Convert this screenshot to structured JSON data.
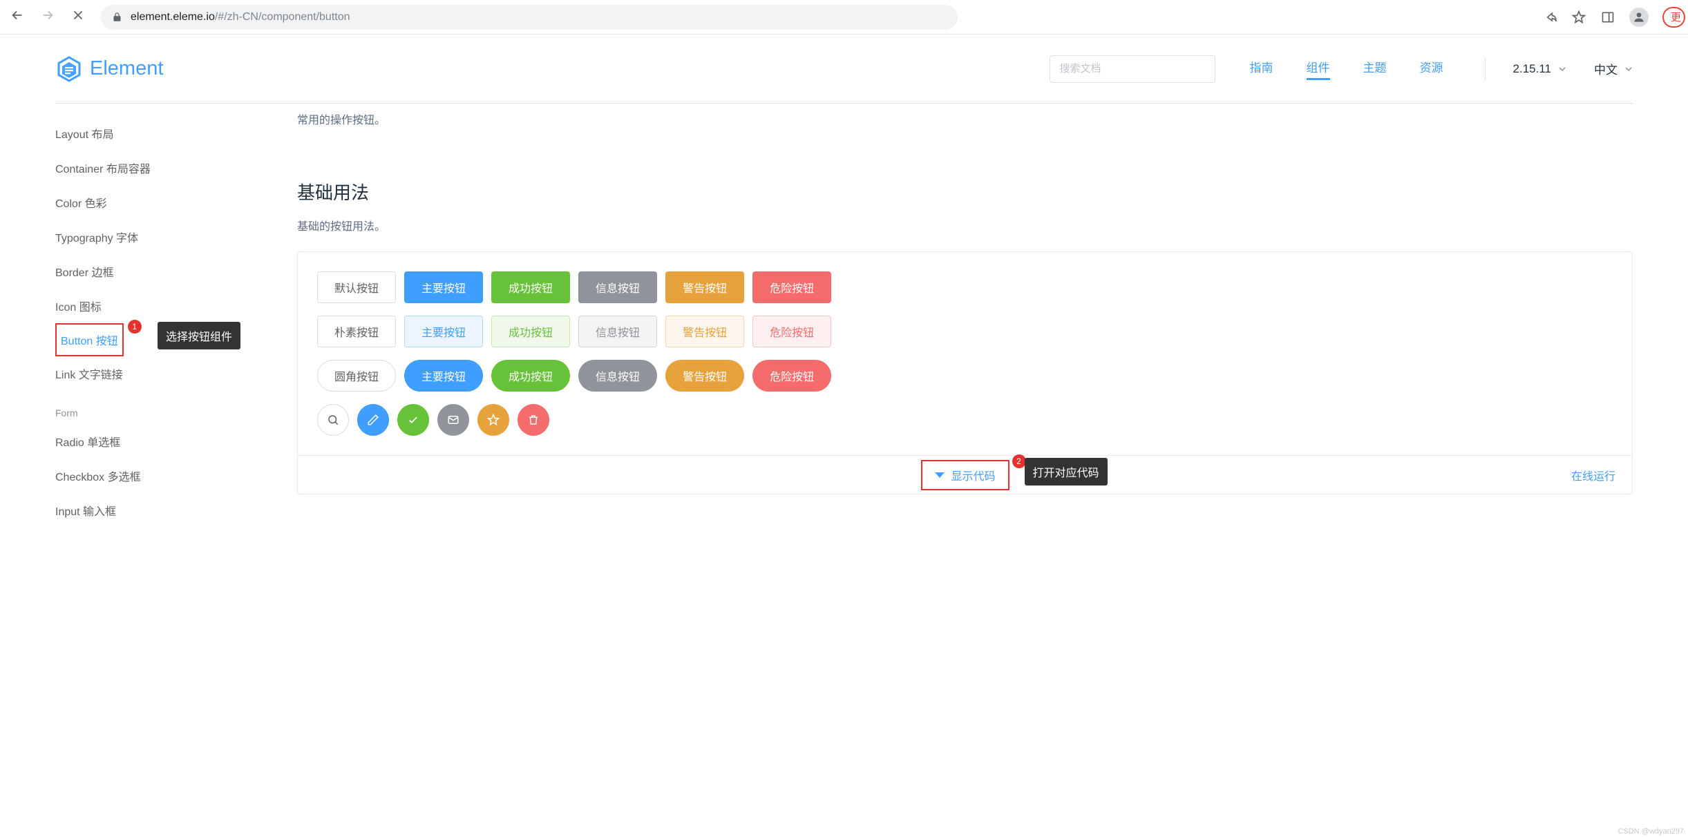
{
  "browser": {
    "url_host": "element.eleme.io",
    "url_path": "/#/zh-CN/component/button",
    "more_label": "更"
  },
  "header": {
    "logo_text": "Element",
    "search_placeholder": "搜索文档",
    "nav": {
      "guide": "指南",
      "component": "组件",
      "theme": "主题",
      "resource": "资源"
    },
    "version": "2.15.11",
    "lang": "中文"
  },
  "sidebar": {
    "items": [
      {
        "label": "Layout 布局"
      },
      {
        "label": "Container 布局容器"
      },
      {
        "label": "Color 色彩"
      },
      {
        "label": "Typography 字体"
      },
      {
        "label": "Border 边框"
      },
      {
        "label": "Icon 图标"
      },
      {
        "label": "Button 按钮",
        "active": true
      },
      {
        "label": "Link 文字链接"
      }
    ],
    "group_form": "Form",
    "form_items": [
      {
        "label": "Radio 单选框"
      },
      {
        "label": "Checkbox 多选框"
      },
      {
        "label": "Input 输入框"
      }
    ]
  },
  "annotations": {
    "badge1": "1",
    "tip1": "选择按钮组件",
    "badge2": "2",
    "tip2": "打开对应代码"
  },
  "content": {
    "intro": "常用的操作按钮。",
    "section_title": "基础用法",
    "section_desc": "基础的按钮用法。",
    "buttons": {
      "default": "默认按钮",
      "primary": "主要按钮",
      "success": "成功按钮",
      "info": "信息按钮",
      "warning": "警告按钮",
      "danger": "危险按钮",
      "plain_default": "朴素按钮",
      "round_default": "圆角按钮"
    },
    "demo_footer": {
      "show_code": "显示代码",
      "run_online": "在线运行"
    }
  },
  "watermark": "CSDN @wdyan297"
}
